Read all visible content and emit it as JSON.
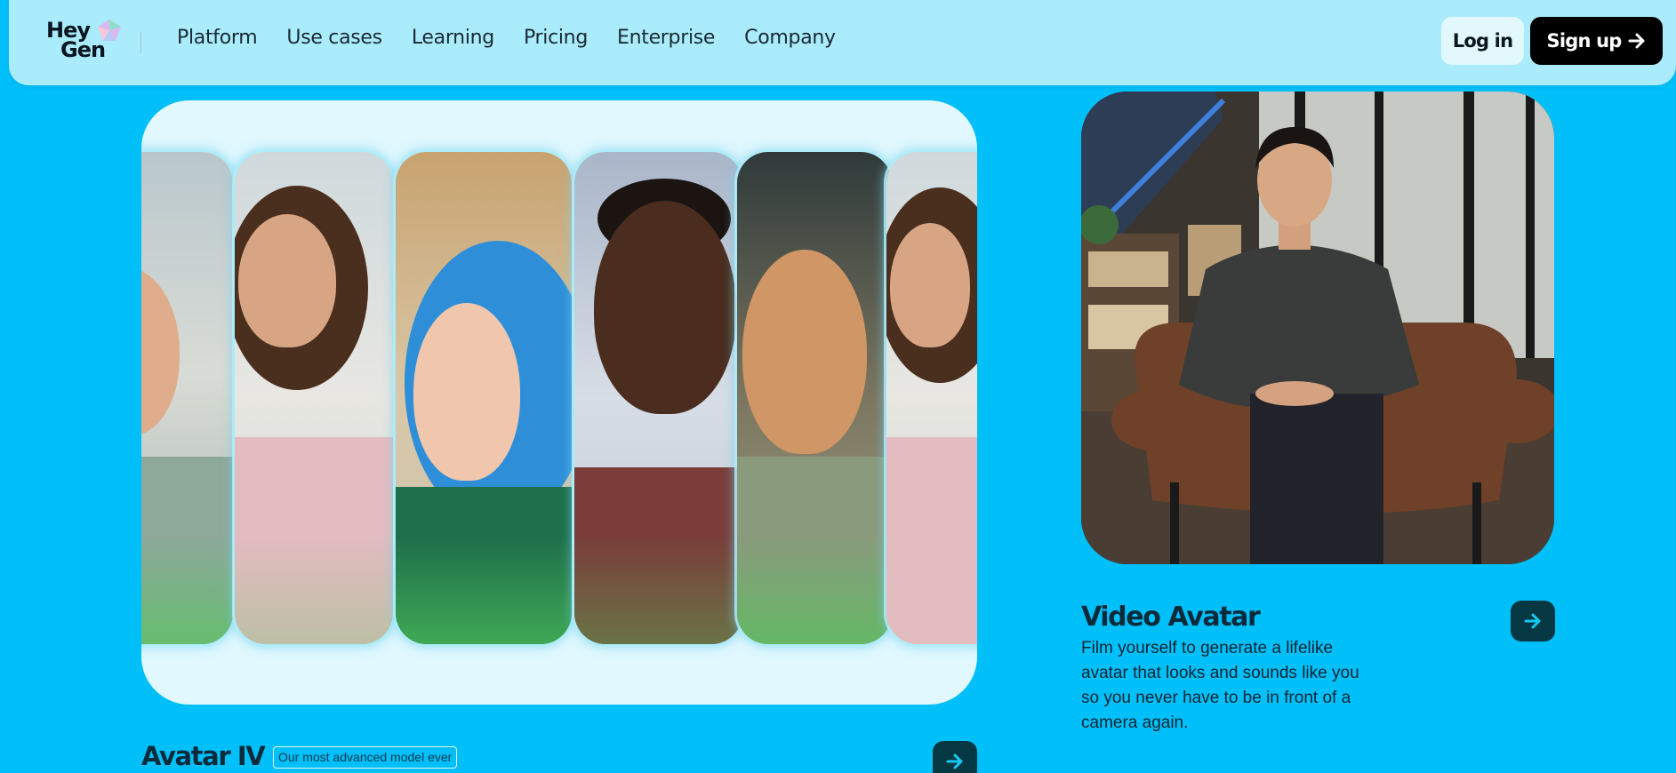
{
  "header": {
    "logo": {
      "line1": "Hey",
      "line2": "Gen"
    },
    "nav": [
      "Platform",
      "Use cases",
      "Learning",
      "Pricing",
      "Enterprise",
      "Company"
    ],
    "login_label": "Log in",
    "signup_label": "Sign up"
  },
  "avatar4": {
    "title": "Avatar IV",
    "tag": "Our most advanced model ever"
  },
  "video_avatar": {
    "title": "Video Avatar",
    "description": "Film yourself to generate a lifelike avatar that looks and sounds like you so you never have to be in front of a camera again."
  },
  "colors": {
    "page_bg": "#00bff9",
    "header_bg": "#aaecfb",
    "card_bg": "#e0f8fe",
    "arrow_button": "#063844",
    "signup_bg": "#000000"
  },
  "icons": [
    "heygen-logo-icon",
    "arrow-right-icon"
  ]
}
